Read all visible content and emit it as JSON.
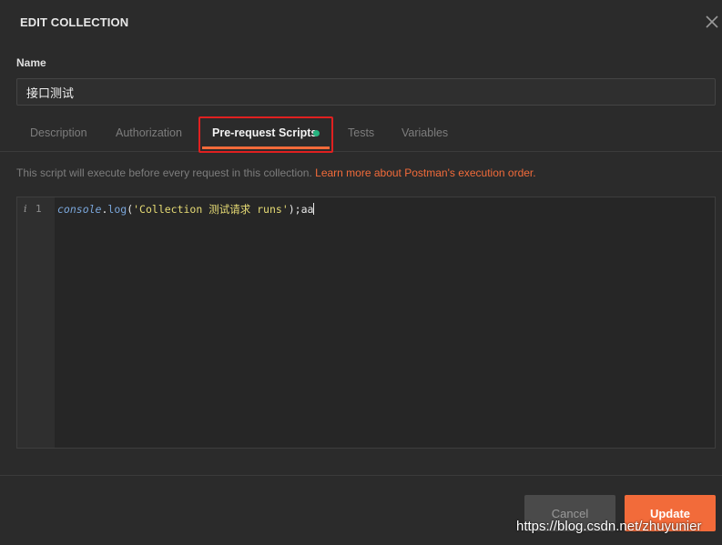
{
  "modal": {
    "title": "EDIT COLLECTION",
    "close_icon": "close-icon"
  },
  "name": {
    "label": "Name",
    "value": "接口测试"
  },
  "tabs": [
    {
      "label": "Description",
      "active": false
    },
    {
      "label": "Authorization",
      "active": false
    },
    {
      "label": "Pre-request Scripts",
      "active": true,
      "has_content_dot": true
    },
    {
      "label": "Tests",
      "active": false
    },
    {
      "label": "Variables",
      "active": false
    }
  ],
  "info": {
    "text": "This script will execute before every request in this collection.",
    "link_text": "Learn more about Postman's execution order."
  },
  "editor": {
    "lint_marker": "i",
    "line_number": "1",
    "code_object": "console",
    "code_dot": ".",
    "code_method": "log",
    "code_open": "(",
    "code_string": "'Collection 测试请求 runs'",
    "code_close": ");aa"
  },
  "buttons": {
    "cancel": "Cancel",
    "update": "Update"
  },
  "watermark": "https://blog.csdn.net/zhuyunier",
  "colors": {
    "accent": "#f26b3a",
    "dot": "#26b47f",
    "highlight_border": "#e02020",
    "background": "#2b2b2b"
  }
}
